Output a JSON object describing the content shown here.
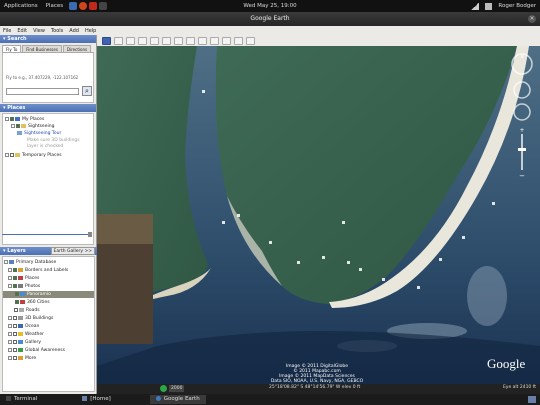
{
  "topbar": {
    "applications": "Applications",
    "places": "Places",
    "clock": "Wed May 25, 19:00",
    "user": "Roger Bodger"
  },
  "window": {
    "title": "Google Earth"
  },
  "menubar": [
    "File",
    "Edit",
    "View",
    "Tools",
    "Add",
    "Help"
  ],
  "search": {
    "header": "Search",
    "tabs": [
      "Fly To",
      "Find Businesses",
      "Directions"
    ],
    "coords": "Fly to e.g., 37.407229, -122.107162",
    "input_value": ""
  },
  "places": {
    "header": "Places",
    "items": [
      {
        "label": "My Places"
      },
      {
        "label": "Sightseeing"
      },
      {
        "label": "Sightseeing Tour",
        "link": true
      },
      {
        "label": "Make sure 3D buildings"
      },
      {
        "label": "layer is checked"
      },
      {
        "label": "Temporary Places"
      }
    ]
  },
  "layers": {
    "header": "Layers",
    "gallery": "Earth Gallery >>",
    "items": [
      {
        "label": "Primary Database"
      },
      {
        "label": "Borders and Labels"
      },
      {
        "label": "Places"
      },
      {
        "label": "Photos"
      },
      {
        "label": "Panoramio",
        "selected": true
      },
      {
        "label": "360 Cities"
      },
      {
        "label": "Roads"
      },
      {
        "label": "3D Buildings"
      },
      {
        "label": "Ocean"
      },
      {
        "label": "Weather"
      },
      {
        "label": "Gallery"
      },
      {
        "label": "Global Awareness"
      },
      {
        "label": "More"
      }
    ]
  },
  "map": {
    "attrib_lines": [
      "Image © 2011 DigitalGlobe",
      "© 2011 Mapabc.com",
      "Image © 2011 MapData Sciences",
      "Data SIO, NOAA, U.S. Navy, NGA, GEBCO"
    ],
    "google": "Google",
    "tour_label": "2000",
    "eye_alt": "Eye alt  2410 ft"
  },
  "statusbar": {
    "coords": "25°18'08.82\" S   48°14'56.79\" W   elev   0 ft"
  },
  "taskbar": {
    "tasks": [
      "Terminal",
      "[Home]",
      "Google Earth"
    ]
  }
}
